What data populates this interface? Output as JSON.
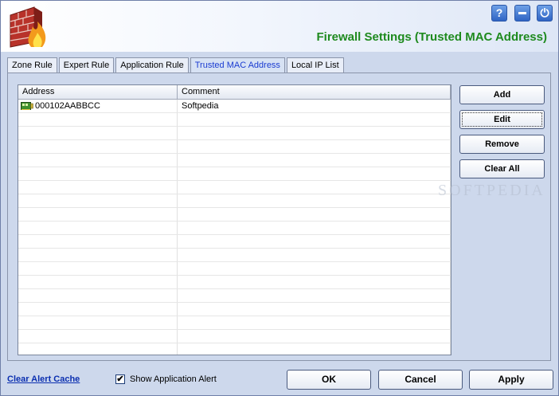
{
  "window": {
    "title": "Firewall Settings (Trusted MAC Address)",
    "title_color": "#1e8a1e",
    "controls": [
      {
        "name": "help",
        "icon": "question-mark-icon",
        "glyph": "?"
      },
      {
        "name": "minimize",
        "icon": "minimize-icon"
      },
      {
        "name": "power",
        "icon": "power-icon",
        "glyph": "⏻"
      }
    ]
  },
  "tabs": [
    {
      "label": "Zone Rule",
      "active": false
    },
    {
      "label": "Expert Rule",
      "active": false
    },
    {
      "label": "Application Rule",
      "active": false
    },
    {
      "label": "Trusted MAC Address",
      "active": true
    },
    {
      "label": "Local IP List",
      "active": false
    }
  ],
  "list": {
    "columns": [
      "Address",
      "Comment"
    ],
    "rows": [
      {
        "address": "000102AABBCC",
        "comment": "Softpedia",
        "icon": "network-card-icon"
      }
    ]
  },
  "side_buttons": {
    "add": "Add",
    "edit": "Edit",
    "remove": "Remove",
    "clear_all": "Clear All"
  },
  "watermark": "SOFTPEDIA",
  "footer": {
    "clear_alert_cache": "Clear Alert Cache",
    "show_app_alert": {
      "label": "Show Application Alert",
      "checked": true
    },
    "ok": "OK",
    "cancel": "Cancel",
    "apply": "Apply"
  }
}
